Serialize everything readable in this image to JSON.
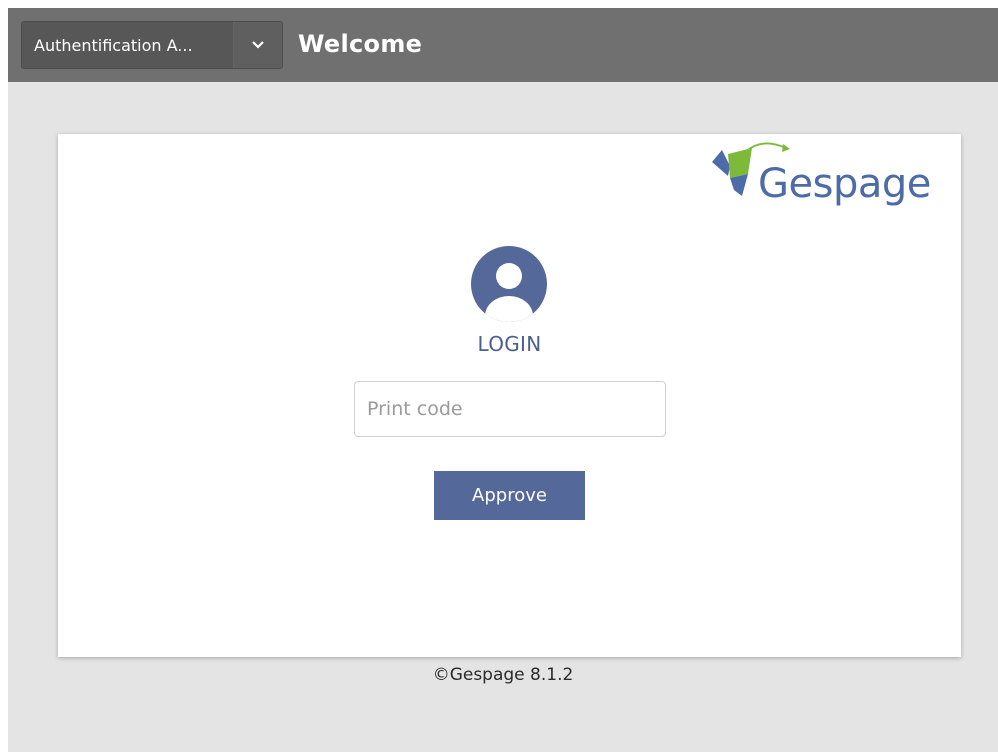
{
  "header": {
    "selector_label": "Authentification A...",
    "selector_icon": "chevron-down-icon",
    "title": "Welcome"
  },
  "brand": {
    "logo_text": "Gespage",
    "color_blue": "#4d6ba6",
    "color_green": "#7dba3a"
  },
  "login": {
    "icon": "user-avatar-icon",
    "title": "LOGIN",
    "code_placeholder": "Print code",
    "code_value": "",
    "approve_label": "Approve"
  },
  "footer": {
    "copyright": "©Gespage 8.1.2"
  },
  "colors": {
    "topbar": "#707070",
    "background": "#e4e4e4",
    "accent": "#54689a"
  }
}
